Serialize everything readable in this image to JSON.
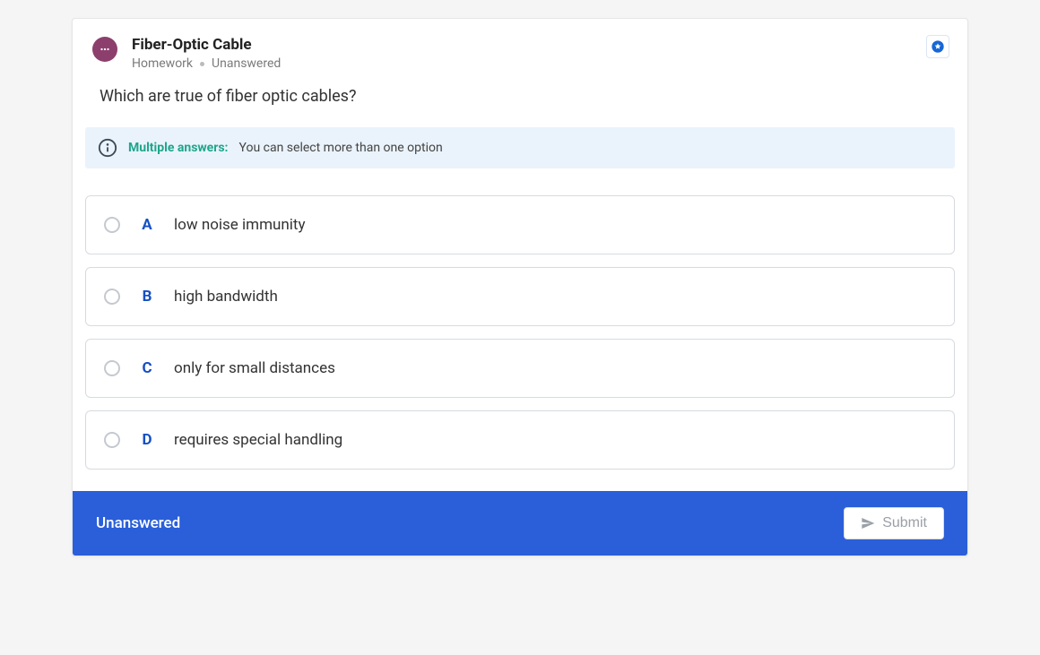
{
  "header": {
    "title": "Fiber-Optic Cable",
    "category": "Homework",
    "status": "Unanswered"
  },
  "question": "Which are true of fiber optic cables?",
  "info": {
    "label": "Multiple answers:",
    "text": "You can select more than one option"
  },
  "options": [
    {
      "letter": "A",
      "text": "low noise immunity"
    },
    {
      "letter": "B",
      "text": "high bandwidth"
    },
    {
      "letter": "C",
      "text": "only for small distances"
    },
    {
      "letter": "D",
      "text": "requires special handling"
    }
  ],
  "footer": {
    "status": "Unanswered",
    "submit": "Submit"
  }
}
